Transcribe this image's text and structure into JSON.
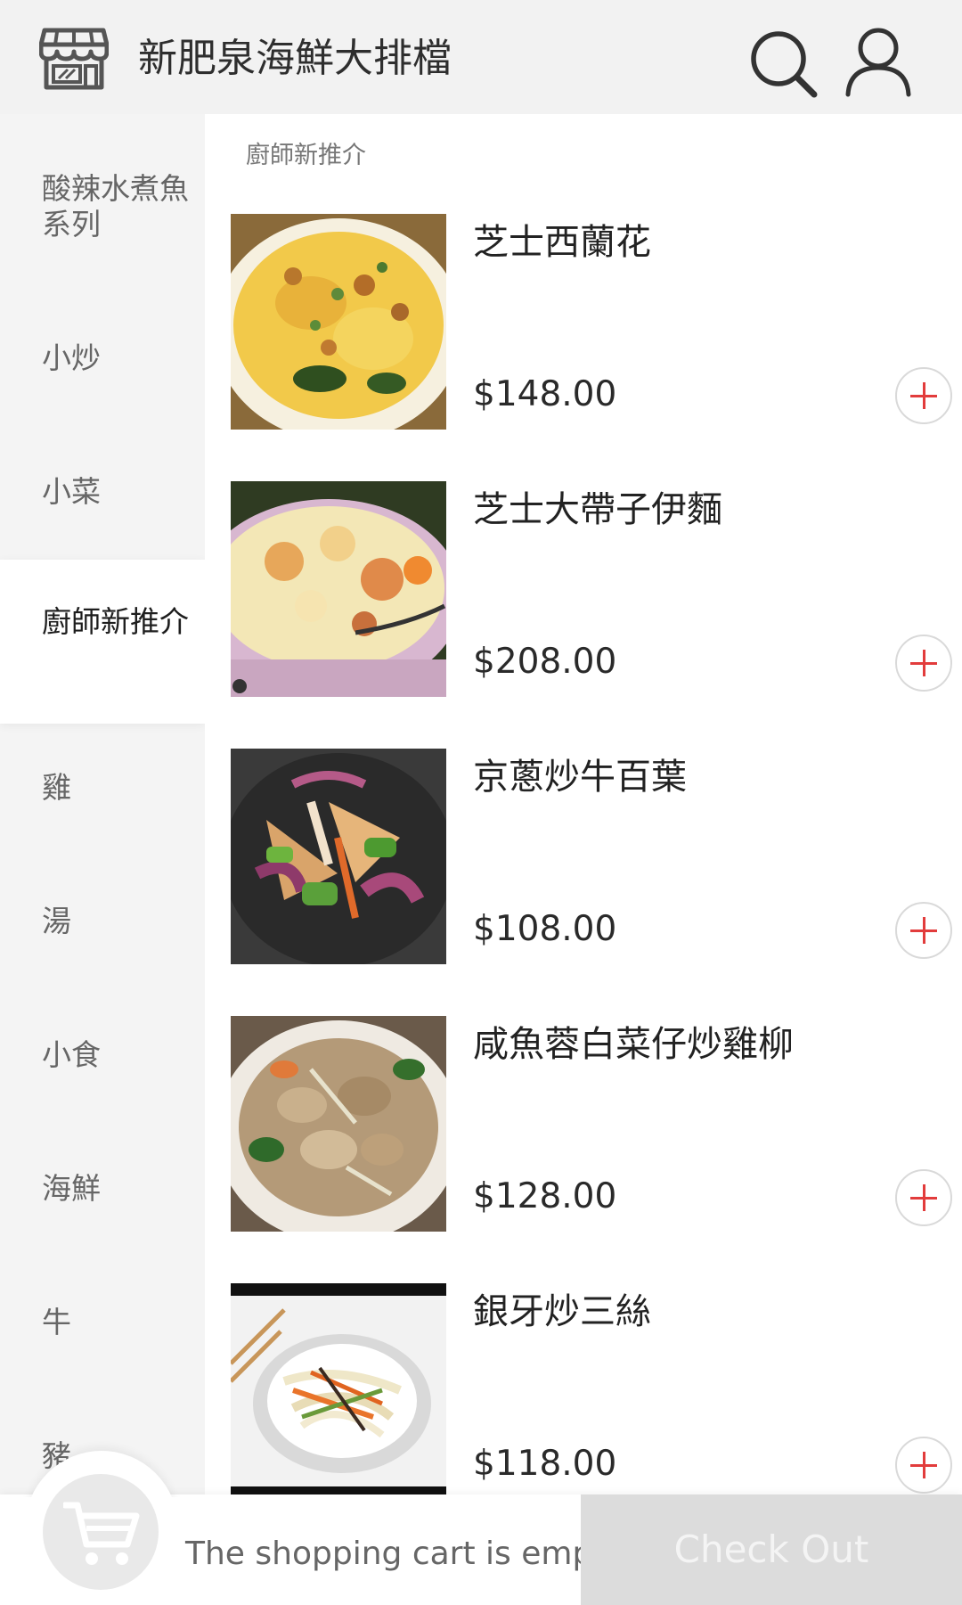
{
  "header": {
    "title": "新肥泉海鮮大排檔",
    "store_icon": "store-icon",
    "search_icon": "search-icon",
    "user_icon": "user-icon"
  },
  "sidebar": {
    "items": [
      {
        "label": "酸辣水煮魚系列",
        "active": false
      },
      {
        "label": "小炒",
        "active": false
      },
      {
        "label": "小菜",
        "active": false
      },
      {
        "label": "廚師新推介",
        "active": true
      },
      {
        "label": "雞",
        "active": false
      },
      {
        "label": "湯",
        "active": false
      },
      {
        "label": "小食",
        "active": false
      },
      {
        "label": "海鮮",
        "active": false
      },
      {
        "label": "牛",
        "active": false
      },
      {
        "label": "豬",
        "active": false
      }
    ]
  },
  "main": {
    "section_title": "廚師新推介",
    "dishes": [
      {
        "name": "芝士西蘭花",
        "price": "$148.00"
      },
      {
        "name": "芝士大帶子伊麵",
        "price": "$208.00"
      },
      {
        "name": "京蔥炒牛百葉",
        "price": "$108.00"
      },
      {
        "name": "咸魚蓉白菜仔炒雞柳",
        "price": "$128.00"
      },
      {
        "name": "銀牙炒三絲",
        "price": "$118.00"
      }
    ]
  },
  "cart": {
    "empty_text": "The shopping cart is empty",
    "checkout_label": "Check Out",
    "cart_icon": "cart-icon"
  },
  "colors": {
    "accent": "#e23c3c",
    "header_bg": "#f2f2f2",
    "sidebar_bg": "#f4f4f4",
    "checkout_bg": "#dcdcdc"
  }
}
